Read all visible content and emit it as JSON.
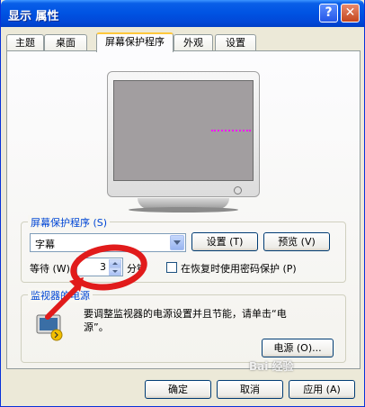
{
  "window": {
    "title": "显示 属性",
    "help_label": "?",
    "close_label": "✕"
  },
  "tabs": [
    {
      "label": "主题",
      "active": false
    },
    {
      "label": "桌面",
      "active": false
    },
    {
      "label": "屏幕保护程序",
      "active": true
    },
    {
      "label": "外观",
      "active": false
    },
    {
      "label": "设置",
      "active": false
    }
  ],
  "screensaver": {
    "group_label": "屏幕保护程序 (S)",
    "selected": "字幕",
    "settings_button": "设置 (T)",
    "preview_button": "预览 (V)",
    "wait_label": "等待 (W):",
    "wait_value": "3",
    "wait_unit": "分钟",
    "password_checkbox_label": "在恢复时使用密码保护 (P)",
    "password_checked": false
  },
  "power": {
    "group_label": "监视器的电源",
    "description_line1": "要调整监视器的电源设置并且节能，请单击“电",
    "description_line2": "源”。",
    "power_button": "电源 (O)..."
  },
  "footer": {
    "ok": "确定",
    "cancel": "取消",
    "apply": "应用 (A)"
  },
  "watermark": "Bai 经验",
  "colors": {
    "title_gradient": "#0054e3",
    "annotation": "#e11b1b",
    "preview_text": "#ff00ff"
  }
}
